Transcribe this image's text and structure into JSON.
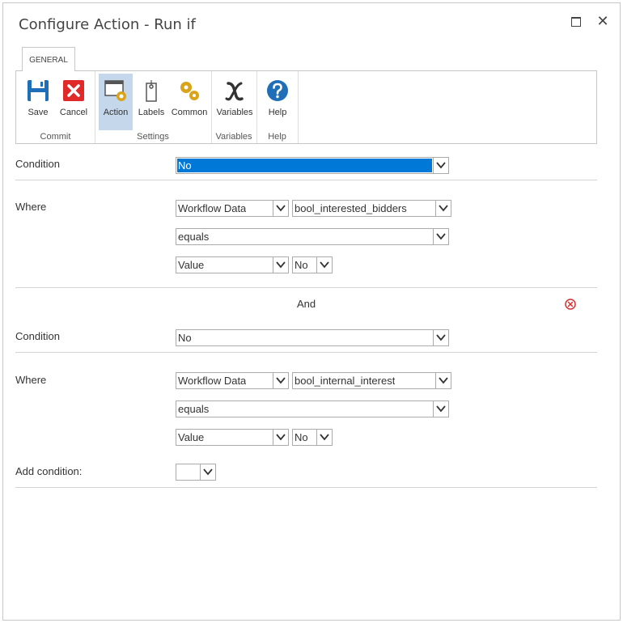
{
  "window": {
    "title": "Configure Action - Run if"
  },
  "ribbon": {
    "tab_label": "GENERAL",
    "groups": {
      "commit": {
        "label": "Commit",
        "save": "Save",
        "cancel": "Cancel"
      },
      "settings": {
        "label": "Settings",
        "action": "Action",
        "labels": "Labels",
        "common": "Common"
      },
      "variables": {
        "label": "Variables",
        "variables": "Variables"
      },
      "help": {
        "label": "Help",
        "help": "Help"
      }
    }
  },
  "condition1": {
    "label": "Condition",
    "value": "No",
    "where_label": "Where",
    "source": "Workflow Data",
    "variable": "bool_interested_bidders",
    "operator": "equals",
    "value_type": "Value"
  },
  "connector": {
    "label": "And"
  },
  "condition2": {
    "label": "Condition",
    "value": "No",
    "where_label": "Where",
    "source": "Workflow Data",
    "variable": "bool_internal_interest",
    "operator": "equals",
    "value_type": "Value"
  },
  "add_condition": {
    "label": "Add condition:",
    "value": ""
  },
  "colors": {
    "accent": "#0078d7",
    "active_button": "#c5d7ea",
    "save_blue": "#1f6fb8",
    "cancel_red": "#e02a2a",
    "gear_gold": "#d9a31a",
    "remove_red": "#d9302f"
  }
}
